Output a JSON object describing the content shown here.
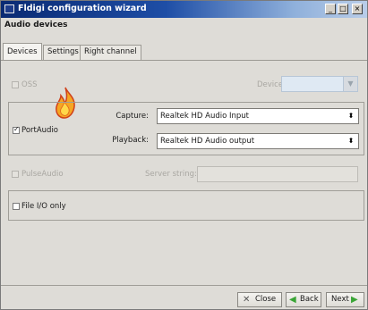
{
  "window": {
    "title": "Fldigi configuration wizard",
    "minimize": "_",
    "maximize": "□",
    "close": "×"
  },
  "header": {
    "title": "Audio devices"
  },
  "tabs": [
    {
      "label": "Devices",
      "active": true
    },
    {
      "label": "Settings",
      "active": false
    },
    {
      "label": "Right channel",
      "active": false
    }
  ],
  "oss": {
    "label": "OSS",
    "checked": false,
    "enabled": false,
    "device_label": "Device:",
    "device_value": ""
  },
  "portaudio": {
    "label": "PortAudio",
    "checked": true,
    "capture_label": "Capture:",
    "capture_value": "Realtek HD Audio Input",
    "playback_label": "Playback:",
    "playback_value": "Realtek HD Audio output"
  },
  "pulseaudio": {
    "label": "PulseAudio",
    "checked": false,
    "enabled": false,
    "server_label": "Server string:",
    "server_value": ""
  },
  "fileio": {
    "label": "File I/O only",
    "checked": false
  },
  "footer": {
    "close_label": "Close",
    "back_label": "Back",
    "next_label": "Next"
  },
  "icons": {
    "close": "x-icon",
    "back": "green-left-arrow-icon",
    "next": "green-right-arrow-icon",
    "flame": "portaudio-flame-icon"
  },
  "colors": {
    "titlebar_start": "#0a2a73",
    "titlebar_end": "#b9cde8",
    "arrow_green": "#3aa536"
  }
}
